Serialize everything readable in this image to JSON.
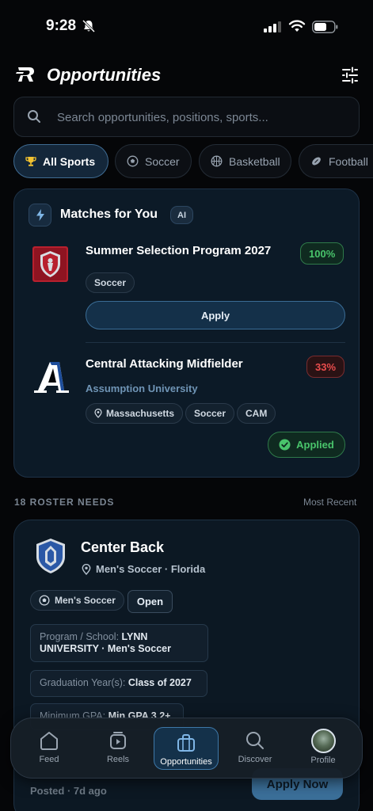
{
  "status_bar": {
    "time": "9:28"
  },
  "header": {
    "title": "Opportunities"
  },
  "search": {
    "placeholder": "Search opportunities, positions, sports..."
  },
  "sport_filters": [
    {
      "label": "All Sports",
      "icon": "trophy-icon",
      "active": true
    },
    {
      "label": "Soccer",
      "icon": "soccer-ball-icon",
      "active": false
    },
    {
      "label": "Basketball",
      "icon": "basketball-icon",
      "active": false
    },
    {
      "label": "Football",
      "icon": "football-icon",
      "active": false
    }
  ],
  "matches": {
    "title": "Matches for You",
    "badge": "AI",
    "items": [
      {
        "title": "Summer Selection Program 2027",
        "match_pct": "100%",
        "tags": [
          "Soccer"
        ],
        "action": "Apply"
      },
      {
        "title": "Central Attacking Midfielder",
        "subtitle": "Assumption University",
        "match_pct": "33%",
        "tags": [
          "Massachusetts",
          "Soccer",
          "CAM"
        ],
        "status": "Applied"
      }
    ]
  },
  "roster": {
    "count_label": "18 ROSTER NEEDS",
    "sort_label": "Most Recent",
    "card": {
      "title": "Center Back",
      "location": "Men's Soccer · Florida",
      "sport_tag": "Men's Soccer",
      "status": "Open",
      "program_label": "Program / School:",
      "program_value": "LYNN UNIVERSITY · Men's Soccer",
      "grad_label": "Graduation Year(s):",
      "grad_value": "Class of 2027",
      "gpa_label": "Minimum GPA:",
      "gpa_value": "Min GPA 3.2+",
      "posted": "Posted · 7d ago",
      "action": "Apply Now"
    }
  },
  "bottom_nav": [
    {
      "label": "Feed",
      "icon": "home-icon",
      "active": false
    },
    {
      "label": "Reels",
      "icon": "reels-icon",
      "active": false
    },
    {
      "label": "Opportunities",
      "icon": "briefcase-icon",
      "active": true
    },
    {
      "label": "Discover",
      "icon": "search-icon",
      "active": false
    },
    {
      "label": "Profile",
      "icon": "avatar",
      "active": false
    }
  ],
  "colors": {
    "background": "#050608",
    "accent": "#3e78a8",
    "success": "#49c46b",
    "danger": "#ea4d4d"
  }
}
